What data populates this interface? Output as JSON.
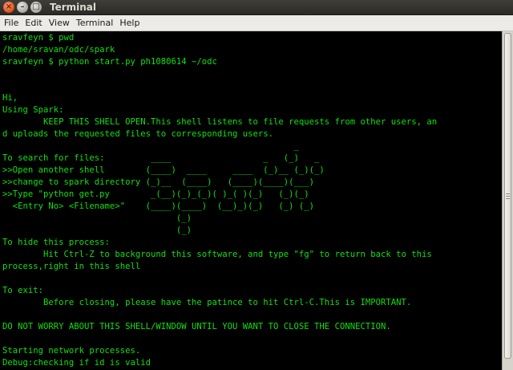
{
  "window": {
    "title": "Terminal",
    "close_glyph": "×",
    "minimize_glyph": "–",
    "maximize_glyph": "□"
  },
  "menubar": {
    "items": [
      "File",
      "Edit",
      "View",
      "Terminal",
      "Help"
    ]
  },
  "terminal": {
    "lines": [
      "sravfeyn $ pwd",
      "/home/sravan/odc/spark",
      "sravfeyn $ python start.py ph1080614 ~/odc",
      "",
      "",
      "Hi,",
      "Using Spark:",
      "        KEEP THIS SHELL OPEN.This shell listens to file requests from other users, an",
      "d uploads the requested files to corresponding users.",
      "                                                         _",
      "To search for files:         ____                  _   (_)   _",
      ">>Open another shell        (____)  ____     ____  (_)__ (_)(_)",
      ">>change to spark directory (_)__  (____)   (____)(____)(___)",
      ">>Type \"python get.py        _(__)(_)_(_)( )_( )(_)   (_)(_)",
      "  <Entry No> <Filename>\"    (____)(____)  (__)_)(_)   (_) (_)",
      "                                  (_)",
      "                                  (_)",
      "To hide this process:",
      "        Hit Ctrl-Z to background this software, and type \"fg\" to return back to this",
      "process,right in this shell",
      "",
      "To exit:",
      "        Before closing, please have the patince to hit Ctrl-C.This is IMPORTANT.",
      "",
      "DO NOT WORRY ABOUT THIS SHELL/WINDOW UNTIL YOU WANT TO CLOSE THE CONNECTION.",
      "",
      "Starting network processes.",
      "Debug:checking if id is valid"
    ]
  },
  "colors": {
    "terminal_background": "#000000",
    "terminal_foreground": "#10e010",
    "close_button": "#e2571d",
    "menubar": "#edebe8",
    "titlebar": "#3a3934"
  },
  "icons": [
    "close-icon",
    "minimize-icon",
    "maximize-icon"
  ]
}
